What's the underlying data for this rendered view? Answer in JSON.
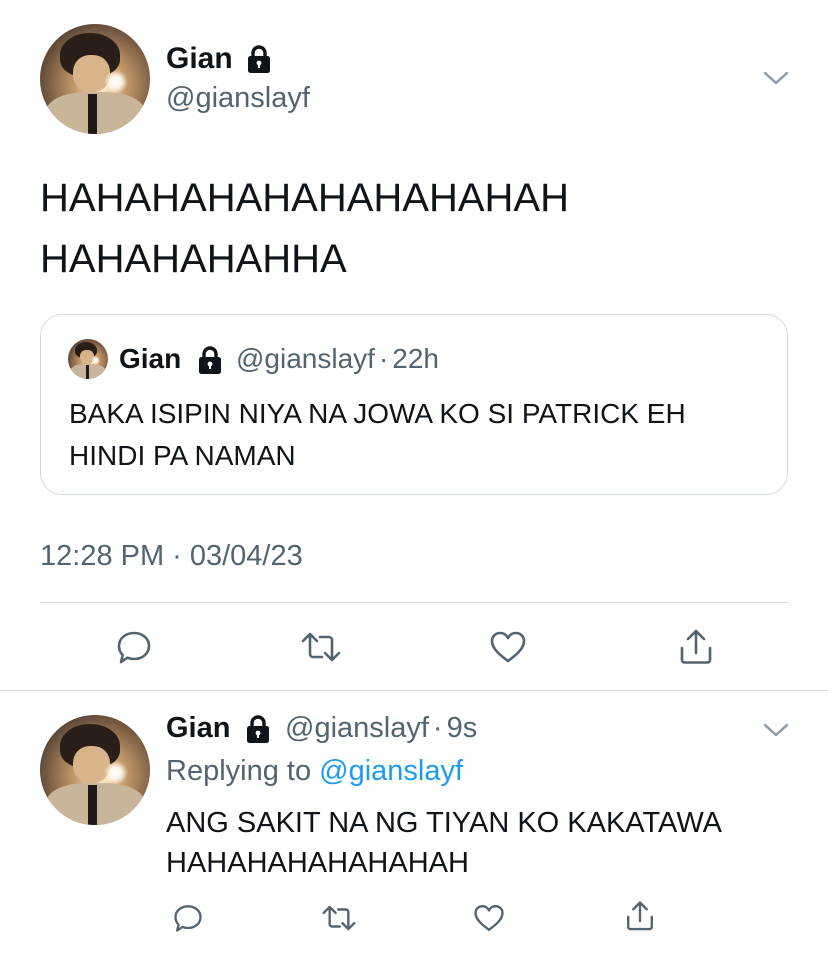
{
  "main_tweet": {
    "author": {
      "name": "Gian",
      "handle": "@gianslayf",
      "locked_icon": "lock-icon",
      "avatar": "profile-avatar"
    },
    "text_lines": [
      "HAHAHAHAHAHAHAHAHAH",
      "HAHAHAHAHHA"
    ],
    "quoted_tweet": {
      "name": "Gian",
      "handle": "@gianslayf",
      "separator": "·",
      "age": "22h",
      "text_lines": [
        "BAKA ISIPIN NIYA NA JOWA KO SI PATRICK EH",
        "HINDI PA NAMAN"
      ]
    },
    "time": "12:28 PM",
    "separator": "·",
    "date": "03/04/23",
    "actions": [
      "reply-icon",
      "retweet-icon",
      "like-icon",
      "share-icon"
    ]
  },
  "reply_tweet": {
    "author": {
      "name": "Gian",
      "handle": "@gianslayf",
      "separator": "·",
      "age": "9s",
      "locked_icon": "lock-icon",
      "avatar": "profile-avatar"
    },
    "replying_to_label": "Replying to",
    "replying_to_handle": "@gianslayf",
    "text_lines": [
      "ANG SAKIT NA NG TIYAN KO KAKATAWA",
      "HAHAHAHAHAHAHAH"
    ],
    "actions": [
      "reply-icon",
      "retweet-icon",
      "like-icon",
      "share-icon"
    ]
  },
  "colors": {
    "text_primary": "#0f1419",
    "text_secondary": "#536471",
    "link": "#1d9bf0",
    "border": "#cfd9de",
    "icon": "#536471"
  }
}
